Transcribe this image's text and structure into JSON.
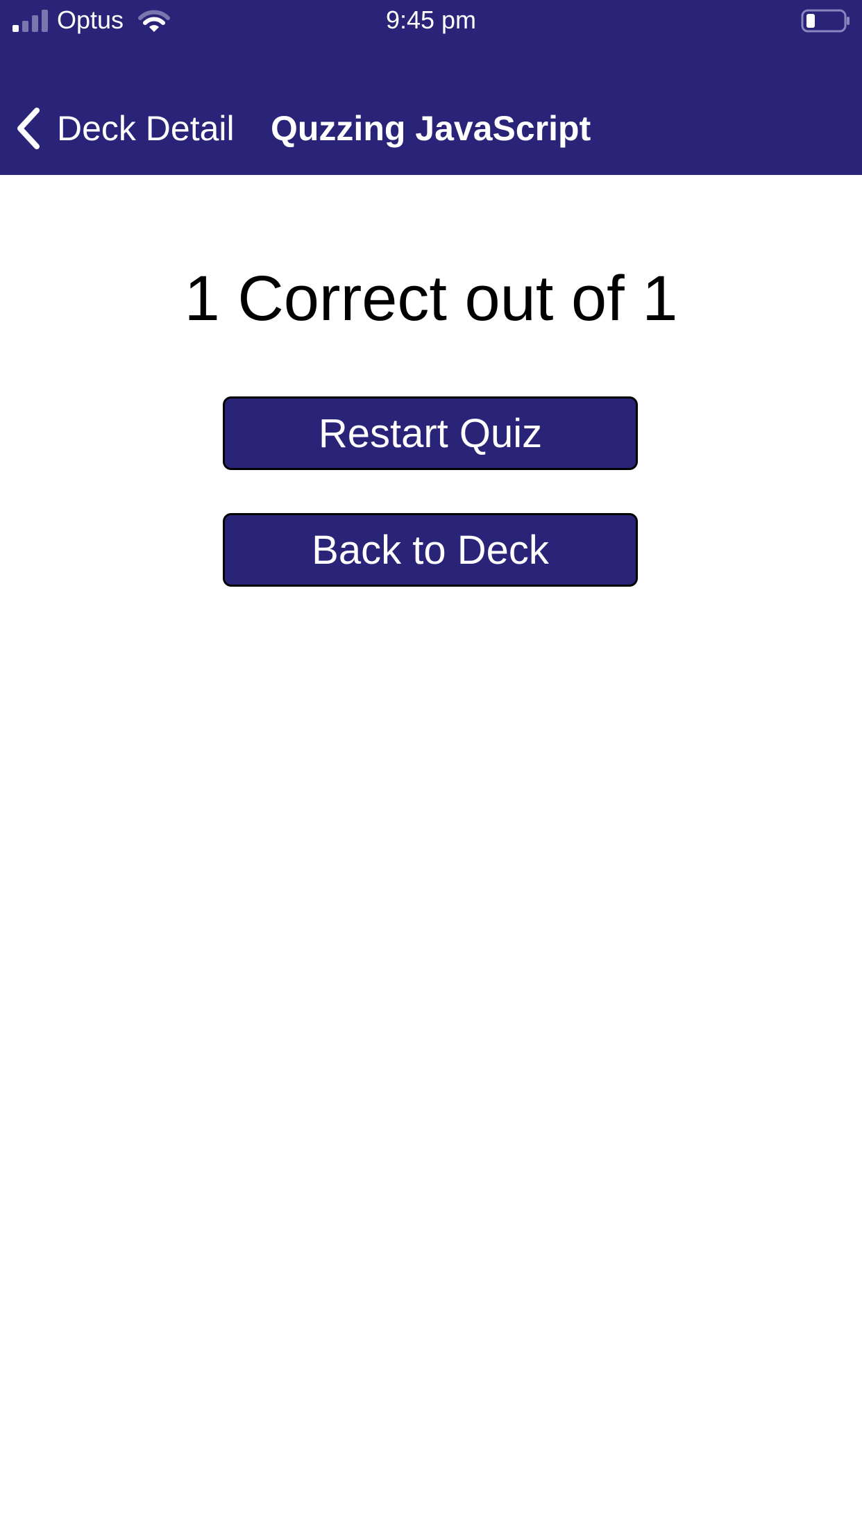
{
  "status_bar": {
    "carrier": "Optus",
    "time": "9:45 pm",
    "signal_icon": "signal-strength-icon",
    "wifi_icon": "wifi-icon",
    "battery_icon": "battery-icon"
  },
  "nav": {
    "back_label": "Deck Detail",
    "back_icon": "chevron-left-icon",
    "title": "Quzzing JavaScript"
  },
  "result": {
    "score_text": "1 Correct out of 1"
  },
  "actions": {
    "restart_label": "Restart Quiz",
    "back_label": "Back to Deck"
  },
  "colors": {
    "header_bg": "#2a2478",
    "button_bg": "#2a2478",
    "button_text": "#ffffff",
    "button_border": "#000000"
  }
}
